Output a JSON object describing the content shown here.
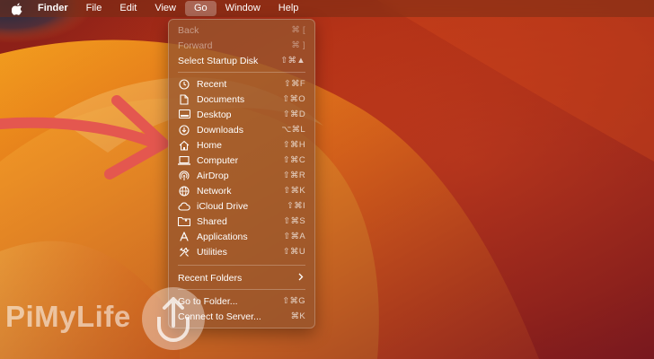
{
  "menubar": {
    "items": [
      {
        "label": "Finder"
      },
      {
        "label": "File"
      },
      {
        "label": "Edit"
      },
      {
        "label": "View"
      },
      {
        "label": "Go"
      },
      {
        "label": "Window"
      },
      {
        "label": "Help"
      }
    ]
  },
  "go_menu": {
    "top": [
      {
        "label": "Back",
        "shortcut": "⌘ [",
        "disabled": true
      },
      {
        "label": "Forward",
        "shortcut": "⌘ ]",
        "disabled": true
      },
      {
        "label": "Select Startup Disk",
        "shortcut": "⇧⌘▲"
      }
    ],
    "places": [
      {
        "label": "Recent",
        "shortcut": "⇧⌘F",
        "icon": "clock-icon"
      },
      {
        "label": "Documents",
        "shortcut": "⇧⌘O",
        "icon": "document-icon"
      },
      {
        "label": "Desktop",
        "shortcut": "⇧⌘D",
        "icon": "desktop-icon"
      },
      {
        "label": "Downloads",
        "shortcut": "⌥⌘L",
        "icon": "download-icon"
      },
      {
        "label": "Home",
        "shortcut": "⇧⌘H",
        "icon": "home-icon"
      },
      {
        "label": "Computer",
        "shortcut": "⇧⌘C",
        "icon": "laptop-icon"
      },
      {
        "label": "AirDrop",
        "shortcut": "⇧⌘R",
        "icon": "airdrop-icon"
      },
      {
        "label": "Network",
        "shortcut": "⇧⌘K",
        "icon": "globe-icon"
      },
      {
        "label": "iCloud Drive",
        "shortcut": "⇧⌘I",
        "icon": "cloud-icon"
      },
      {
        "label": "Shared",
        "shortcut": "⇧⌘S",
        "icon": "shared-folder-icon"
      },
      {
        "label": "Applications",
        "shortcut": "⇧⌘A",
        "icon": "applications-icon"
      },
      {
        "label": "Utilities",
        "shortcut": "⇧⌘U",
        "icon": "utilities-icon"
      }
    ],
    "recent_folders": {
      "label": "Recent Folders"
    },
    "bottom": [
      {
        "label": "Go to Folder...",
        "shortcut": "⇧⌘G"
      },
      {
        "label": "Connect to Server...",
        "shortcut": "⌘K"
      }
    ]
  },
  "watermark": {
    "text": "PiMyLife"
  },
  "colors": {
    "accent": "#e4574f",
    "menubar": "#7a2d14"
  }
}
